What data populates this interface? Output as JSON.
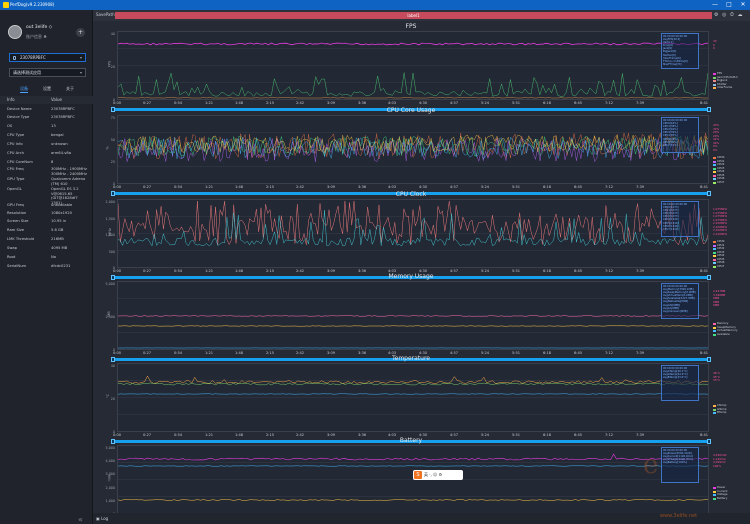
{
  "window": {
    "title": "PerfDog(v9.2.230908)",
    "controls": [
      "—",
      "□",
      "✕"
    ]
  },
  "sidebar": {
    "user": {
      "name": "out 3elife ◇",
      "status": "账户信息 ♣"
    },
    "device": "23078RPBFC",
    "app_select": "请选择测试应用",
    "tabs": [
      "设备",
      "设置",
      "关于"
    ],
    "info_header": {
      "k": "Info",
      "v": "Value"
    },
    "info": [
      {
        "k": "Device Name",
        "v": "23078RPBFC"
      },
      {
        "k": "Device Type",
        "v": "23078RPBFC"
      },
      {
        "k": "OS",
        "v": "13"
      },
      {
        "k": "CPU Type",
        "v": "bengal"
      },
      {
        "k": "CPU Info",
        "v": "unknown"
      },
      {
        "k": "CPU Arch",
        "v": "arm64-v8a"
      },
      {
        "k": "CPU CoreNum",
        "v": "8"
      },
      {
        "k": "CPU Freq",
        "v": "300MHz - 1900MHz\n300MHz - 2400MHz"
      },
      {
        "k": "GPU Type",
        "v": "Qualcomm Adreno\n(TM) 610"
      },
      {
        "k": "OpenGL",
        "v": "OpenGL ES 3.2\nV@0615.65\n(GIT@1628df7\n1301)"
      },
      {
        "k": "GPU Freq",
        "v": "unavailable"
      },
      {
        "k": "Resolution",
        "v": "1080x1920"
      },
      {
        "k": "Screen Size",
        "v": "10.95 in"
      },
      {
        "k": "Ram Size",
        "v": "5.6 GB"
      },
      {
        "k": "LMK Threshold",
        "v": "216MB"
      },
      {
        "k": "Swap",
        "v": "4095 MB"
      },
      {
        "k": "Root",
        "v": "No"
      },
      {
        "k": "SerialNum",
        "v": "dfcdc0231"
      }
    ],
    "collapse": "«"
  },
  "toolbar": {
    "sf_label": "SavePath",
    "label": "label1",
    "icons": [
      "⚙",
      "◎",
      "⏱",
      "☁"
    ]
  },
  "x_ticks": [
    "0:00",
    "0:27",
    "0:54",
    "1:21",
    "1:48",
    "2:15",
    "2:42",
    "3:09",
    "3:36",
    "4:03",
    "4:30",
    "4:57",
    "5:24",
    "5:51",
    "6:18",
    "6:45",
    "7:12",
    "7:39",
    "8:41"
  ],
  "charts": [
    {
      "title": "FPS",
      "ylabel": "FPS",
      "yticks": [
        "40",
        "20",
        "0"
      ],
      "legend_lines": [
        "00:00:00 00:00:00",
        "AvgFPS[30.5]",
        "Var[0.1]",
        "Drop[0]",
        "Jank[0]",
        "BigJank[0]",
        "Stutter[0]",
        "InterFrame[0]",
        "FTime>=100ms[0]",
        "MaxFTime[33]"
      ],
      "right": [
        {
          "c": "#e53ce0",
          "t": "FPS"
        },
        {
          "c": "#7ad06a",
          "t": "Jank(CPU/GPU)"
        },
        {
          "c": "#e88",
          "t": "BigJank"
        },
        {
          "c": "#8bd",
          "t": "Stutter"
        },
        {
          "c": "#ffb04a",
          "t": "InterFrame"
        }
      ],
      "vals": [
        "30",
        "0",
        "0"
      ]
    },
    {
      "title": "CPU Core Usage",
      "ylabel": "%",
      "yticks": [
        "75",
        "50",
        "25",
        "0"
      ],
      "legend_lines": [
        "00:00:00 00:00:00",
        "CPU0[42%]",
        "CPU1[38%]",
        "CPU2[40%]",
        "CPU3[39%]",
        "CPU4[35%]",
        "CPU5[33%]",
        "CPU6[30%]",
        "CPU7[31%]"
      ],
      "right": [
        {
          "c": "#e74",
          "t": "CPU0"
        },
        {
          "c": "#b6f",
          "t": "CPU1"
        },
        {
          "c": "#4bf",
          "t": "CPU2"
        },
        {
          "c": "#4d8",
          "t": "CPU3"
        },
        {
          "c": "#fc4",
          "t": "CPU4"
        },
        {
          "c": "#f6a",
          "t": "CPU5"
        },
        {
          "c": "#6cf",
          "t": "CPU6"
        },
        {
          "c": "#9e6",
          "t": "CPU7"
        }
      ],
      "vals": [
        "43%",
        "32%",
        "29%",
        "29%",
        "41%",
        "44%",
        "0%",
        "0%"
      ]
    },
    {
      "title": "CPU Clock",
      "ylabel": "MHz",
      "yticks": [
        "2,000",
        "1,500",
        "1,000",
        "500",
        "0"
      ],
      "legend_lines": [
        "00:00:00 00:00:00",
        "CPU0[1073]",
        "CPU1[1073]",
        "CPU2[1073]",
        "CPU3[1073]",
        "CPU4[1340]",
        "CPU5[1340]",
        "CPU6[1340]",
        "CPU7[1340]"
      ],
      "right": [
        {
          "c": "#e74",
          "t": "CPU0"
        },
        {
          "c": "#b6f",
          "t": "CPU1"
        },
        {
          "c": "#4bf",
          "t": "CPU2"
        },
        {
          "c": "#4d8",
          "t": "CPU3"
        },
        {
          "c": "#fc4",
          "t": "CPU4"
        },
        {
          "c": "#f6a",
          "t": "CPU5"
        },
        {
          "c": "#6cf",
          "t": "CPU6"
        },
        {
          "c": "#9e6",
          "t": "CPU7"
        }
      ],
      "vals": [
        "1,075MHz",
        "1,075MHz",
        "1,075MHz",
        "1,075MHz",
        "2,100MHz",
        "2,100MHz",
        "2,100MHz",
        "2,100MHz"
      ]
    },
    {
      "title": "Memory Usage",
      "ylabel": "MB",
      "yticks": [
        "5,000",
        "2,500",
        "0"
      ],
      "legend_lines": [
        "00:00:00 00:00:00",
        "AvgMemory[3396.1MB]",
        "AvgSwapMemory[0.0MB]",
        "AvgVirtualMem[0.0MB]",
        "AvgAvailable[2227.3MB]",
        "AvgNativePss[0MB]",
        "AvgGfx[0MB]",
        "AvgGL[0MB]",
        "AvgUnknown[0MB]"
      ],
      "right": [
        {
          "c": "#f6a",
          "t": "Memory"
        },
        {
          "c": "#fc4",
          "t": "SwapMemory"
        },
        {
          "c": "#4bf",
          "t": "VirtualMemory"
        },
        {
          "c": "#4d8",
          "t": "Available"
        }
      ],
      "vals": [
        "2,227MB",
        "3,396MB",
        "0MB",
        "0MB",
        "0MB"
      ]
    },
    {
      "title": "Temperature",
      "ylabel": "°C",
      "yticks": [
        "40",
        "20",
        "0"
      ],
      "legend_lines": [
        "00:00:00 00:00:00",
        "AvgCTemp[46.1°C]",
        "AvgGTemp[44.9°C]",
        "AvgBTemp[33.0°C]"
      ],
      "right": [
        {
          "c": "#ffb04a",
          "t": "CTemp"
        },
        {
          "c": "#7ad06a",
          "t": "GTemp"
        },
        {
          "c": "#4bf",
          "t": "BTemp"
        }
      ],
      "vals": [
        "46°C",
        "45°C",
        "33°C"
      ]
    },
    {
      "title": "Battery",
      "ylabel": "mW",
      "yticks": [
        "5,000",
        "4,000",
        "3,000",
        "2,000",
        "1,000",
        "0"
      ],
      "legend_lines": [
        "00:00:00 00:00:00",
        "AvgPower[4590.4mW]",
        "AvgCurrent[1126.0mA]",
        "AvgVoltage[4090.0mV]",
        "AvgBattery[100%]"
      ],
      "right": [
        {
          "c": "#e53ce0",
          "t": "Power"
        },
        {
          "c": "#fc4",
          "t": "Current"
        },
        {
          "c": "#4bf",
          "t": "Voltage"
        },
        {
          "c": "#4d8",
          "t": "Battery"
        }
      ],
      "vals": [
        "4,590mW",
        "1,120mA",
        "4,099mV",
        "100%"
      ]
    }
  ],
  "bottom": {
    "log": "Log"
  },
  "watermarks": {
    "badge": "S",
    "badge_icons": "英 ·, ☺ ⚙",
    "site": "www.3elife.net",
    "logo": "e"
  },
  "colors": {
    "titlebar": "#0f64c3",
    "label": "#c74b5c",
    "scroll": "#17a0ee",
    "accent": "#4aa3ff"
  }
}
